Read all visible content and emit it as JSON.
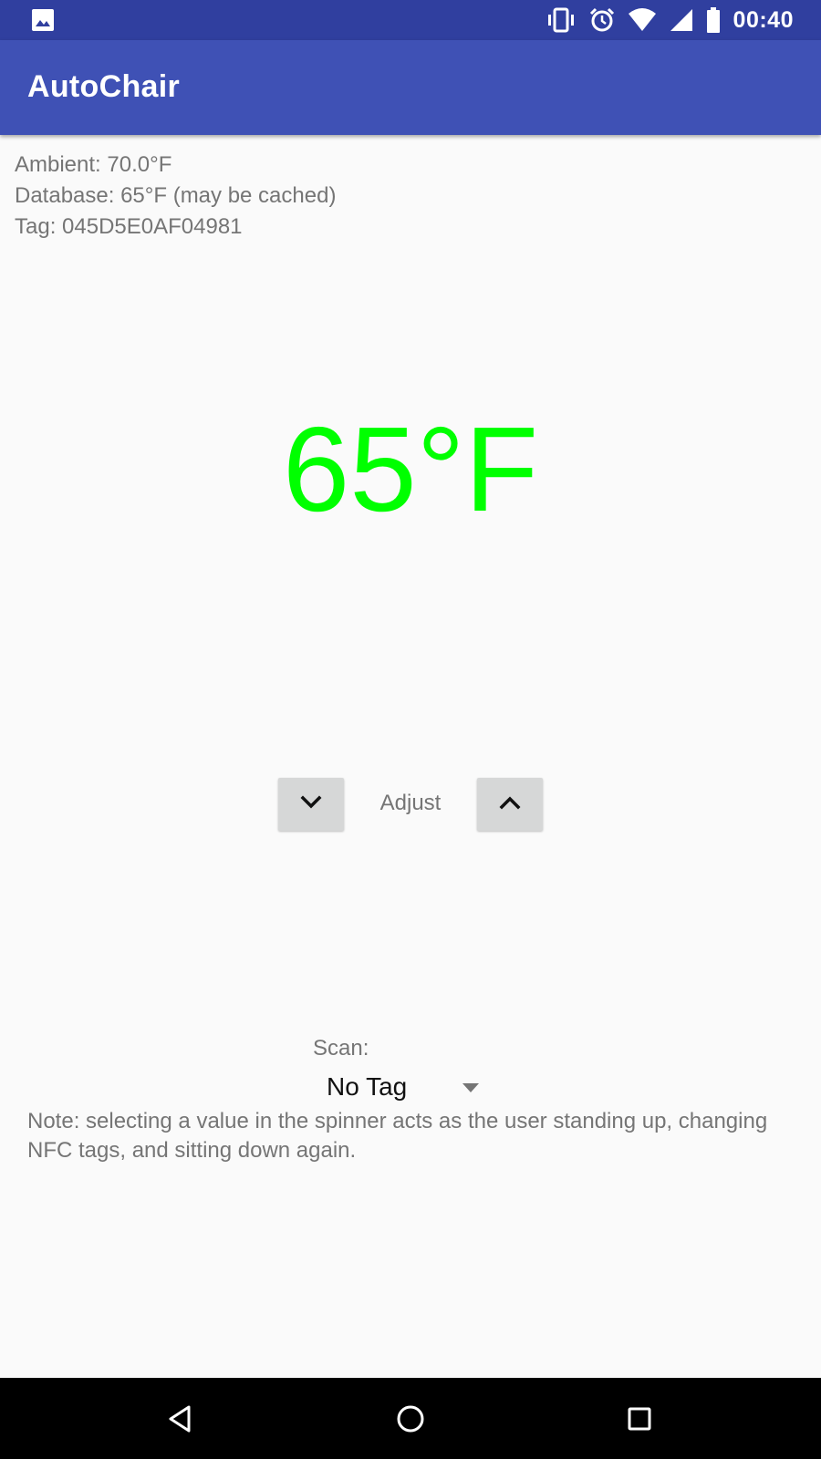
{
  "status_bar": {
    "left_icons": [
      "image-notification-icon"
    ],
    "right_icons": [
      "vibrate-icon",
      "alarm-icon",
      "wifi-icon",
      "cell-signal-icon",
      "battery-icon"
    ],
    "time": "00:40"
  },
  "app_bar": {
    "title": "AutoChair"
  },
  "info": {
    "ambient": "Ambient: 70.0°F",
    "database": "Database: 65°F (may be cached)",
    "tag": "Tag: 045D5E0AF04981"
  },
  "temperature": {
    "display": "65°F",
    "color": "#00ff00"
  },
  "adjust": {
    "label": "Adjust",
    "down_icon": "chevron-down-icon",
    "up_icon": "chevron-up-icon"
  },
  "scan": {
    "label": "Scan:",
    "selected": "No Tag"
  },
  "note": "Note: selecting a value in the spinner acts as the user standing up, changing NFC tags, and sitting down again.",
  "nav_bar": {
    "buttons": [
      "back-icon",
      "home-icon",
      "recents-icon"
    ]
  },
  "colors": {
    "status_bar": "#303f9f",
    "app_bar": "#3f51b5",
    "background": "#fafafa",
    "secondary_text": "#757575",
    "button": "#d6d7d7"
  }
}
